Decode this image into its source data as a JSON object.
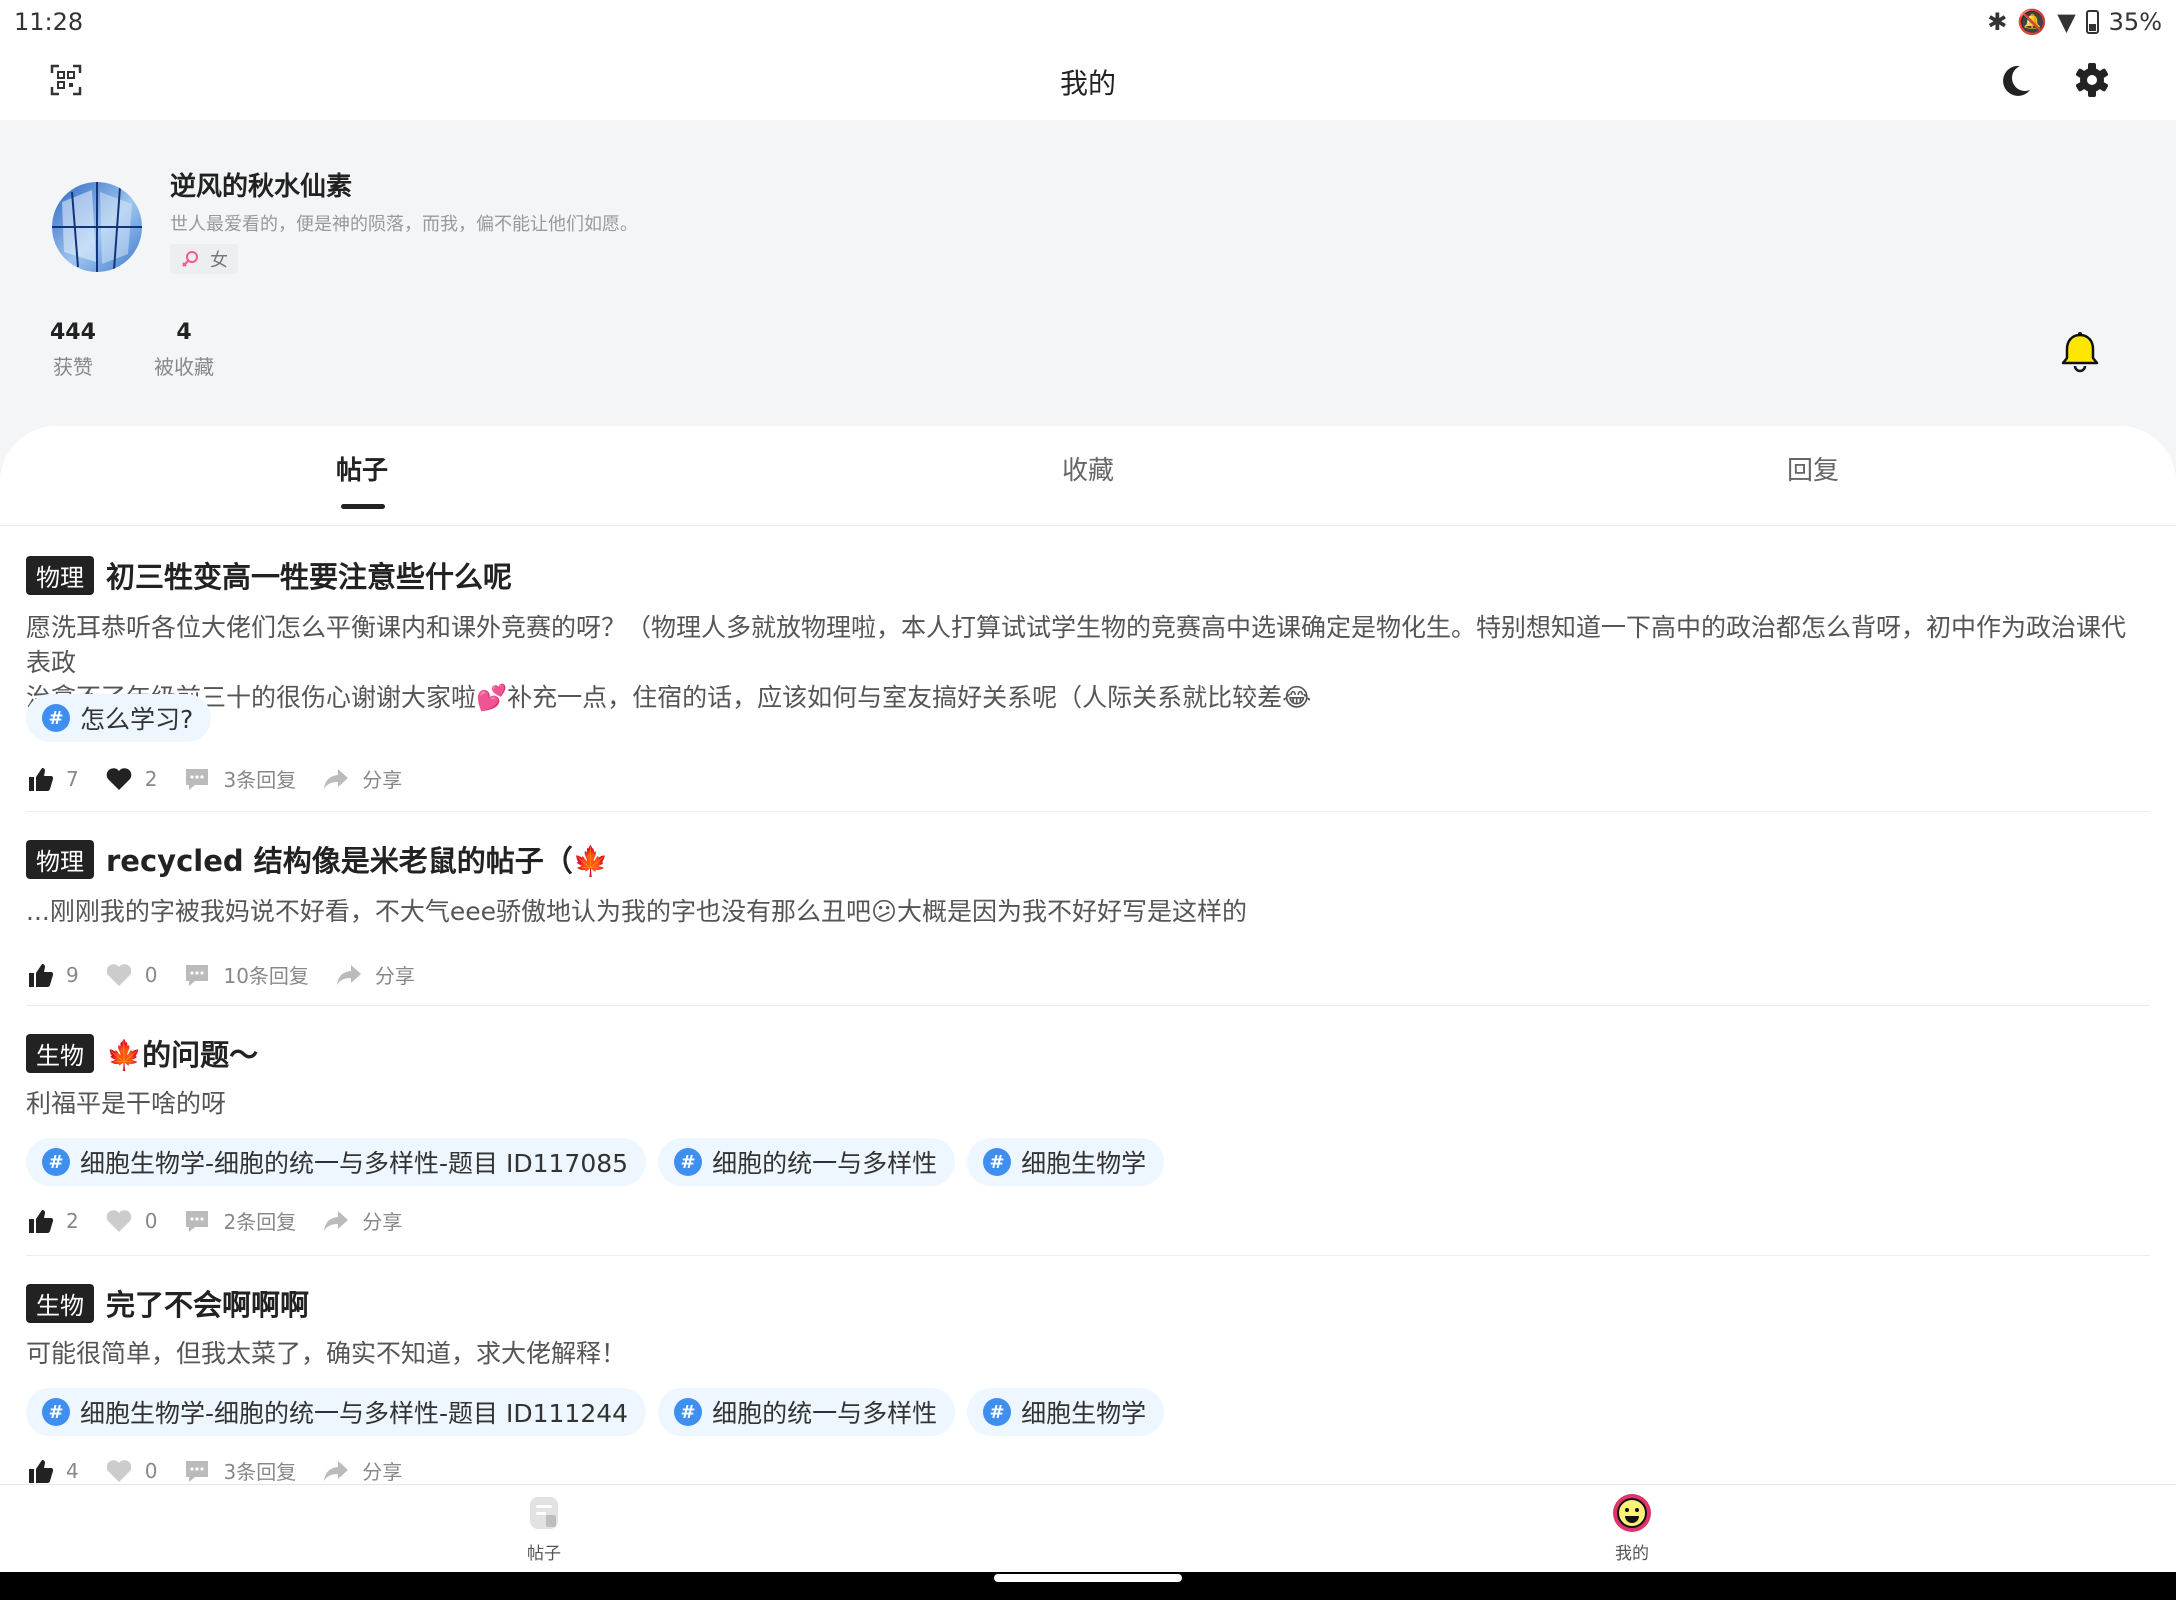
{
  "status_bar": {
    "time": "11:28",
    "battery": "35%"
  },
  "header": {
    "title": "我的"
  },
  "profile": {
    "username": "逆风的秋水仙素",
    "bio": "世人最爱看的，便是神的陨落，而我，偏不能让他们如愿。",
    "gender": "女",
    "stats": [
      {
        "value": "444",
        "label": "获赞"
      },
      {
        "value": "4",
        "label": "被收藏"
      }
    ]
  },
  "tabs": [
    {
      "label": "帖子",
      "active": true
    },
    {
      "label": "收藏",
      "active": false
    },
    {
      "label": "回复",
      "active": false
    }
  ],
  "posts": [
    {
      "category": "物理",
      "title": "初三牲变高一牲要注意些什么呢",
      "body_lines": [
        "愿洗耳恭听各位大佬们怎么平衡课内和课外竞赛的呀？（物理人多就放物理啦，本人打算试试学生物的竞赛高中选课确定是物化生。特别想知道一下高中的政治都怎么背呀，初中作为政治课代表政",
        "治拿不了年级前三十的很伤心谢谢大家啦💕补充一点，住宿的话，应该如何与室友搞好关系呢（人际关系就比较差😂"
      ],
      "topics": [
        "怎么学习?"
      ],
      "likes": "7",
      "favorites": "2",
      "favorited": true,
      "replies": "3条回复",
      "share": "分享"
    },
    {
      "category": "物理",
      "title": "recycled 结构像是米老鼠的帖子（🍁",
      "body_lines": [
        "...刚刚我的字被我妈说不好看，不大气eee骄傲地认为我的字也没有那么丑吧😕大概是因为我不好好写是这样的"
      ],
      "topics": [],
      "likes": "9",
      "favorites": "0",
      "favorited": false,
      "replies": "10条回复",
      "share": "分享"
    },
    {
      "category": "生物",
      "title": "🍁的问题～",
      "body_lines": [
        "利福平是干啥的呀"
      ],
      "topics": [
        "细胞生物学-细胞的统一与多样性-题目 ID117085",
        "细胞的统一与多样性",
        "细胞生物学"
      ],
      "likes": "2",
      "favorites": "0",
      "favorited": false,
      "replies": "2条回复",
      "share": "分享"
    },
    {
      "category": "生物",
      "title": "完了不会啊啊啊",
      "body_lines": [
        "可能很简单，但我太菜了，确实不知道，求大佬解释！"
      ],
      "topics": [
        "细胞生物学-细胞的统一与多样性-题目 ID111244",
        "细胞的统一与多样性",
        "细胞生物学"
      ],
      "likes": "4",
      "favorites": "0",
      "favorited": false,
      "replies": "3条回复",
      "share": "分享"
    }
  ],
  "bottom_nav": [
    {
      "label": "帖子",
      "icon": "posts-icon"
    },
    {
      "label": "我的",
      "icon": "smiley-icon"
    }
  ],
  "icons": {
    "scan": "qr-scan-icon",
    "dark_mode": "moon-icon",
    "settings": "gear-icon",
    "notifications": "bell-icon",
    "hashtag": "hash-icon"
  },
  "colors": {
    "bell": "#ffe600",
    "topic_bg": "#eef6ff",
    "hash": "#3f8ff0",
    "category_bg": "#222222",
    "me_ring": "#e0336b"
  }
}
